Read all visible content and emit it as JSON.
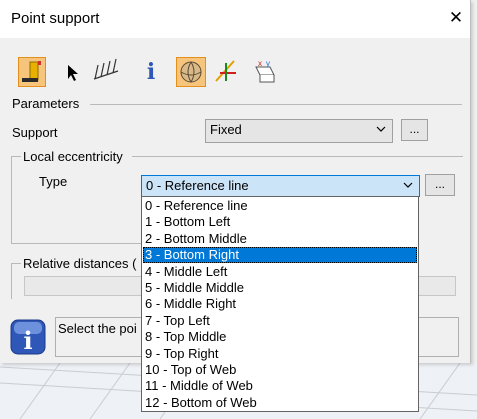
{
  "dialog": {
    "title": "Point support",
    "close_glyph": "✕"
  },
  "toolbar": {
    "buttons": [
      {
        "name": "new-support-icon",
        "selected": true
      },
      {
        "name": "select-arrow-icon",
        "selected": false
      },
      {
        "name": "multi-select-icon",
        "selected": false
      },
      {
        "name": "info-icon",
        "glyph": "i",
        "selected": false
      },
      {
        "name": "sphere-icon",
        "selected": true
      },
      {
        "name": "axis-icon",
        "selected": false
      },
      {
        "name": "coordinate-system-icon",
        "selected": false
      }
    ]
  },
  "parameters": {
    "heading": "Parameters",
    "support_label": "Support",
    "support_value": "Fixed",
    "browse_label": "...",
    "local_eccentricity_heading": "Local eccentricity",
    "type_label": "Type",
    "type_value": "0 - Reference line",
    "type_browse_label": "...",
    "relative_distances_heading": "Relative distances ("
  },
  "type_options": [
    "0 - Reference line",
    "1 - Bottom Left",
    "2 - Bottom Middle",
    "3 - Bottom Right",
    "4 - Middle Left",
    "5 - Middle Middle",
    "6 - Middle Right",
    "7 - Top Left",
    "8 - Top Middle",
    "9 - Top Right",
    "10 - Top of Web",
    "11 - Middle of Web",
    "12 - Bottom of Web"
  ],
  "selected_option_index": 3,
  "status": {
    "message": "Select the poi",
    "icon": "info-icon"
  },
  "colors": {
    "selection": "#0078d7",
    "toolbar_selected": "#f6c57b",
    "info_icon": "#2f57b8"
  }
}
